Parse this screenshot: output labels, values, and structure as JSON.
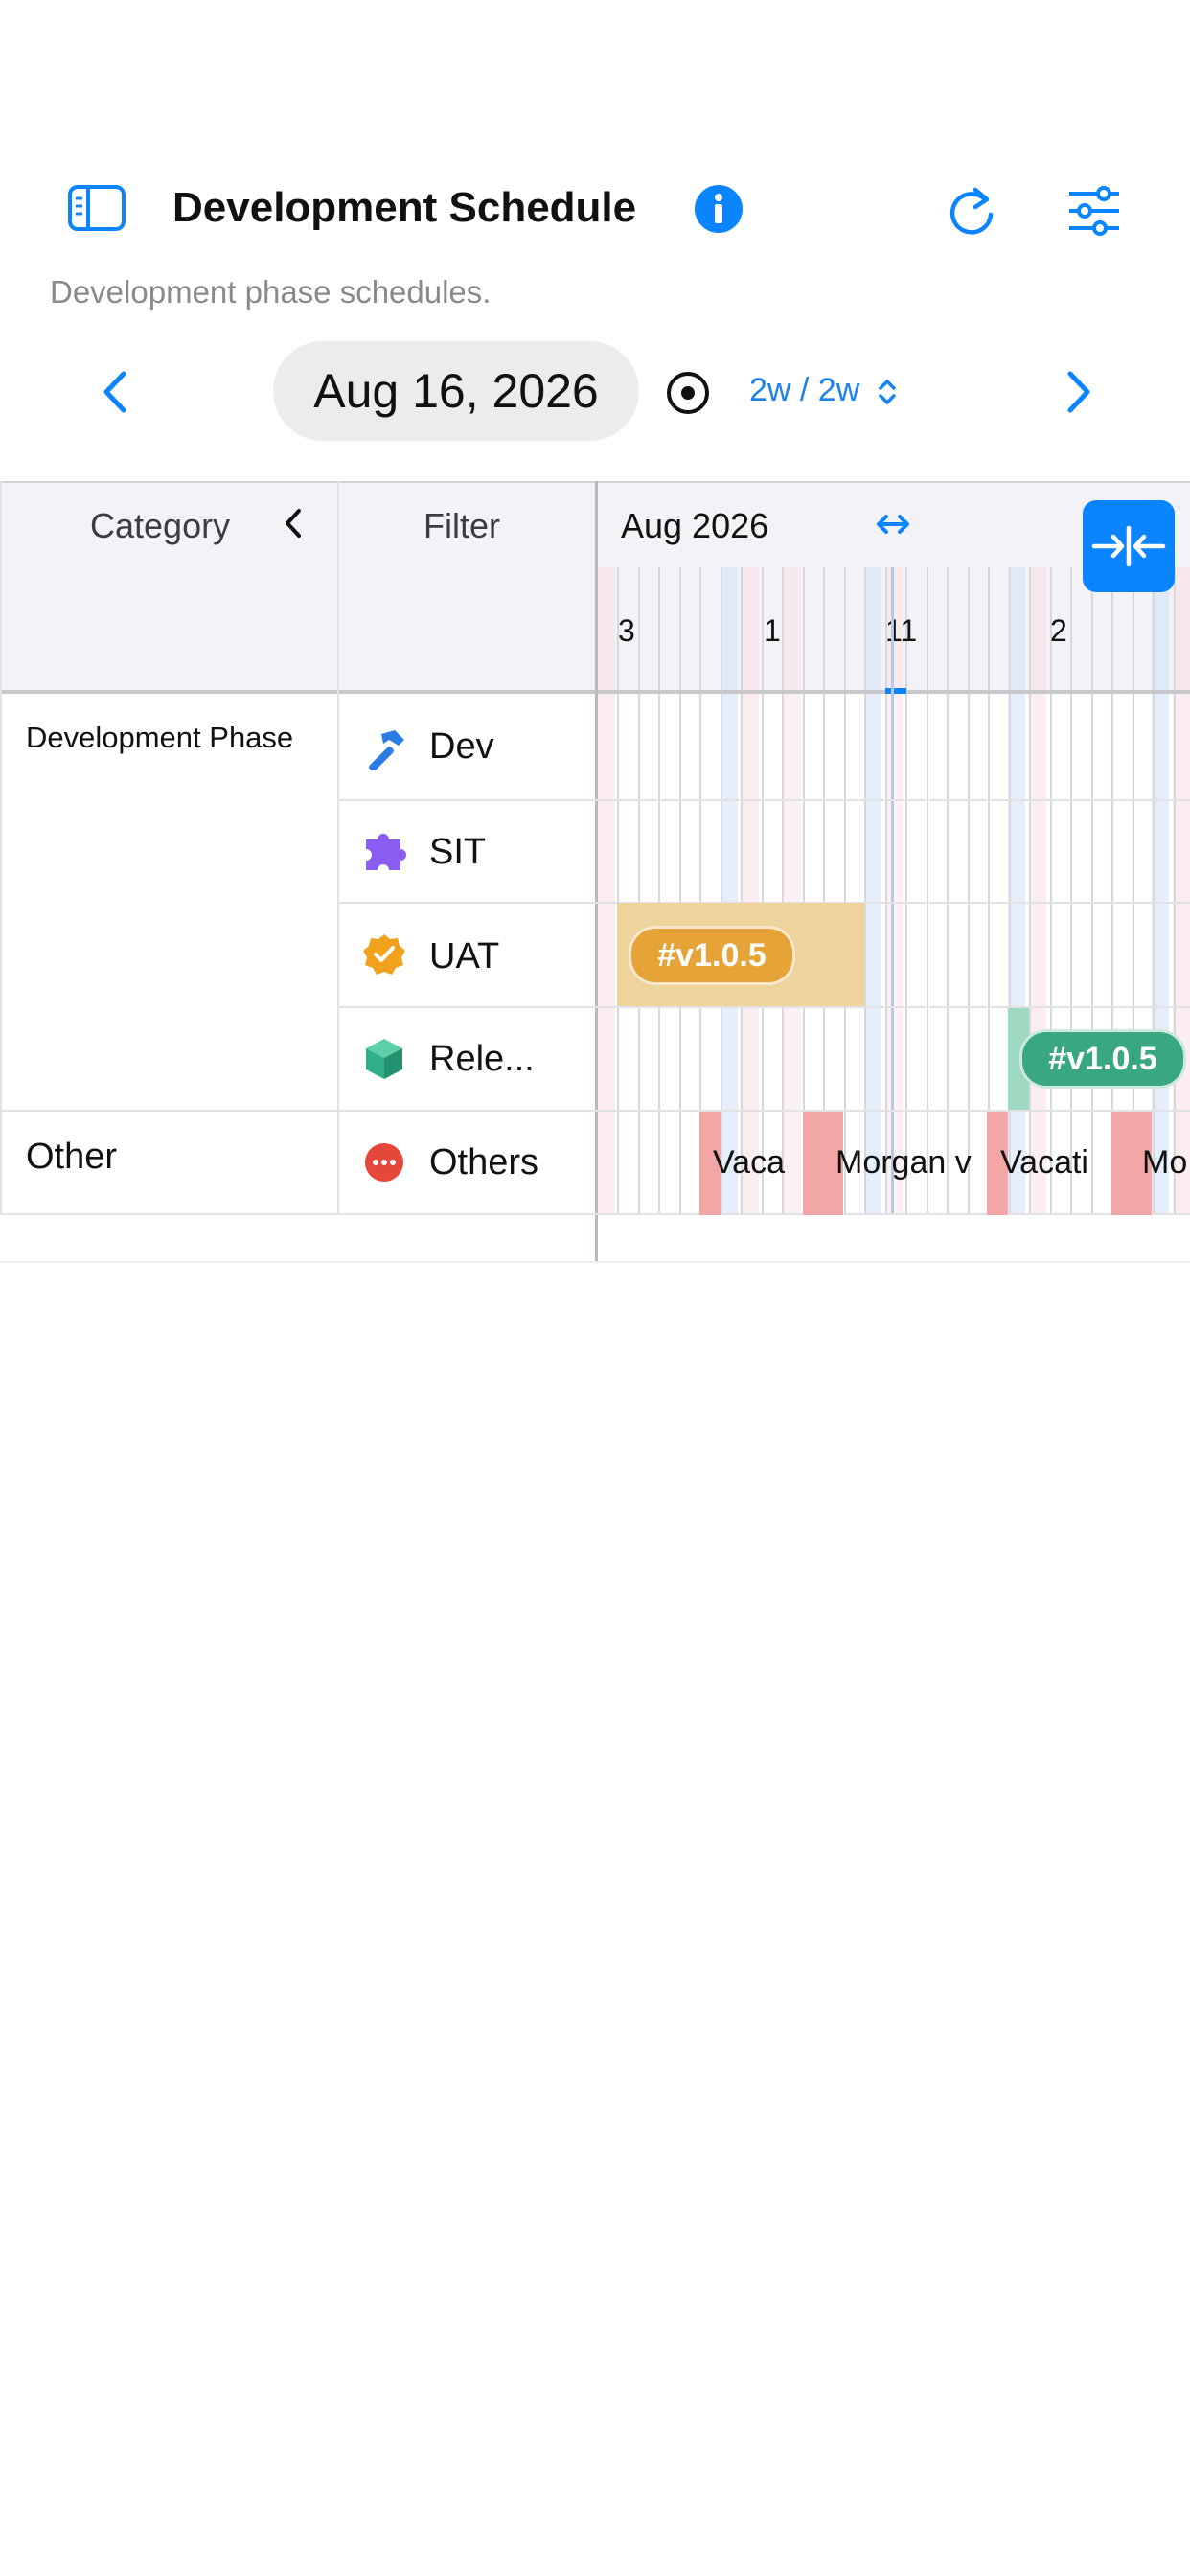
{
  "header": {
    "title": "Development Schedule",
    "subtitle": "Development phase schedules."
  },
  "navigation": {
    "date": "Aug 16, 2026",
    "range": "2w / 2w"
  },
  "table": {
    "col_category": "Category",
    "col_filter": "Filter",
    "month_label": "Aug 2026",
    "day_ticks": [
      "3",
      "1",
      "11",
      "2"
    ],
    "groups": [
      {
        "name": "Development Phase",
        "rows": [
          {
            "label": "Dev",
            "icon": "hammer-icon",
            "color": "#2a7be4"
          },
          {
            "label": "SIT",
            "icon": "puzzle-icon",
            "color": "#8a5cf0"
          },
          {
            "label": "UAT",
            "icon": "badge-check-icon",
            "color": "#f0a21c"
          },
          {
            "label": "Rele...",
            "icon": "cube-icon",
            "color": "#2fae8a"
          }
        ]
      },
      {
        "name": "Other",
        "rows": [
          {
            "label": "Others",
            "icon": "more-icon",
            "color": "#e5483a"
          }
        ]
      }
    ],
    "tasks": {
      "uat_version": "#v1.0.5",
      "release_version": "#v1.0.5"
    },
    "events": [
      "Vaca",
      "Morgan v",
      "Vacati",
      "Mo"
    ]
  },
  "colors": {
    "accent": "#0a84ff",
    "uat_pill": "#e6a337",
    "release_pill": "#39a77f",
    "event": "#f2a6a6"
  }
}
